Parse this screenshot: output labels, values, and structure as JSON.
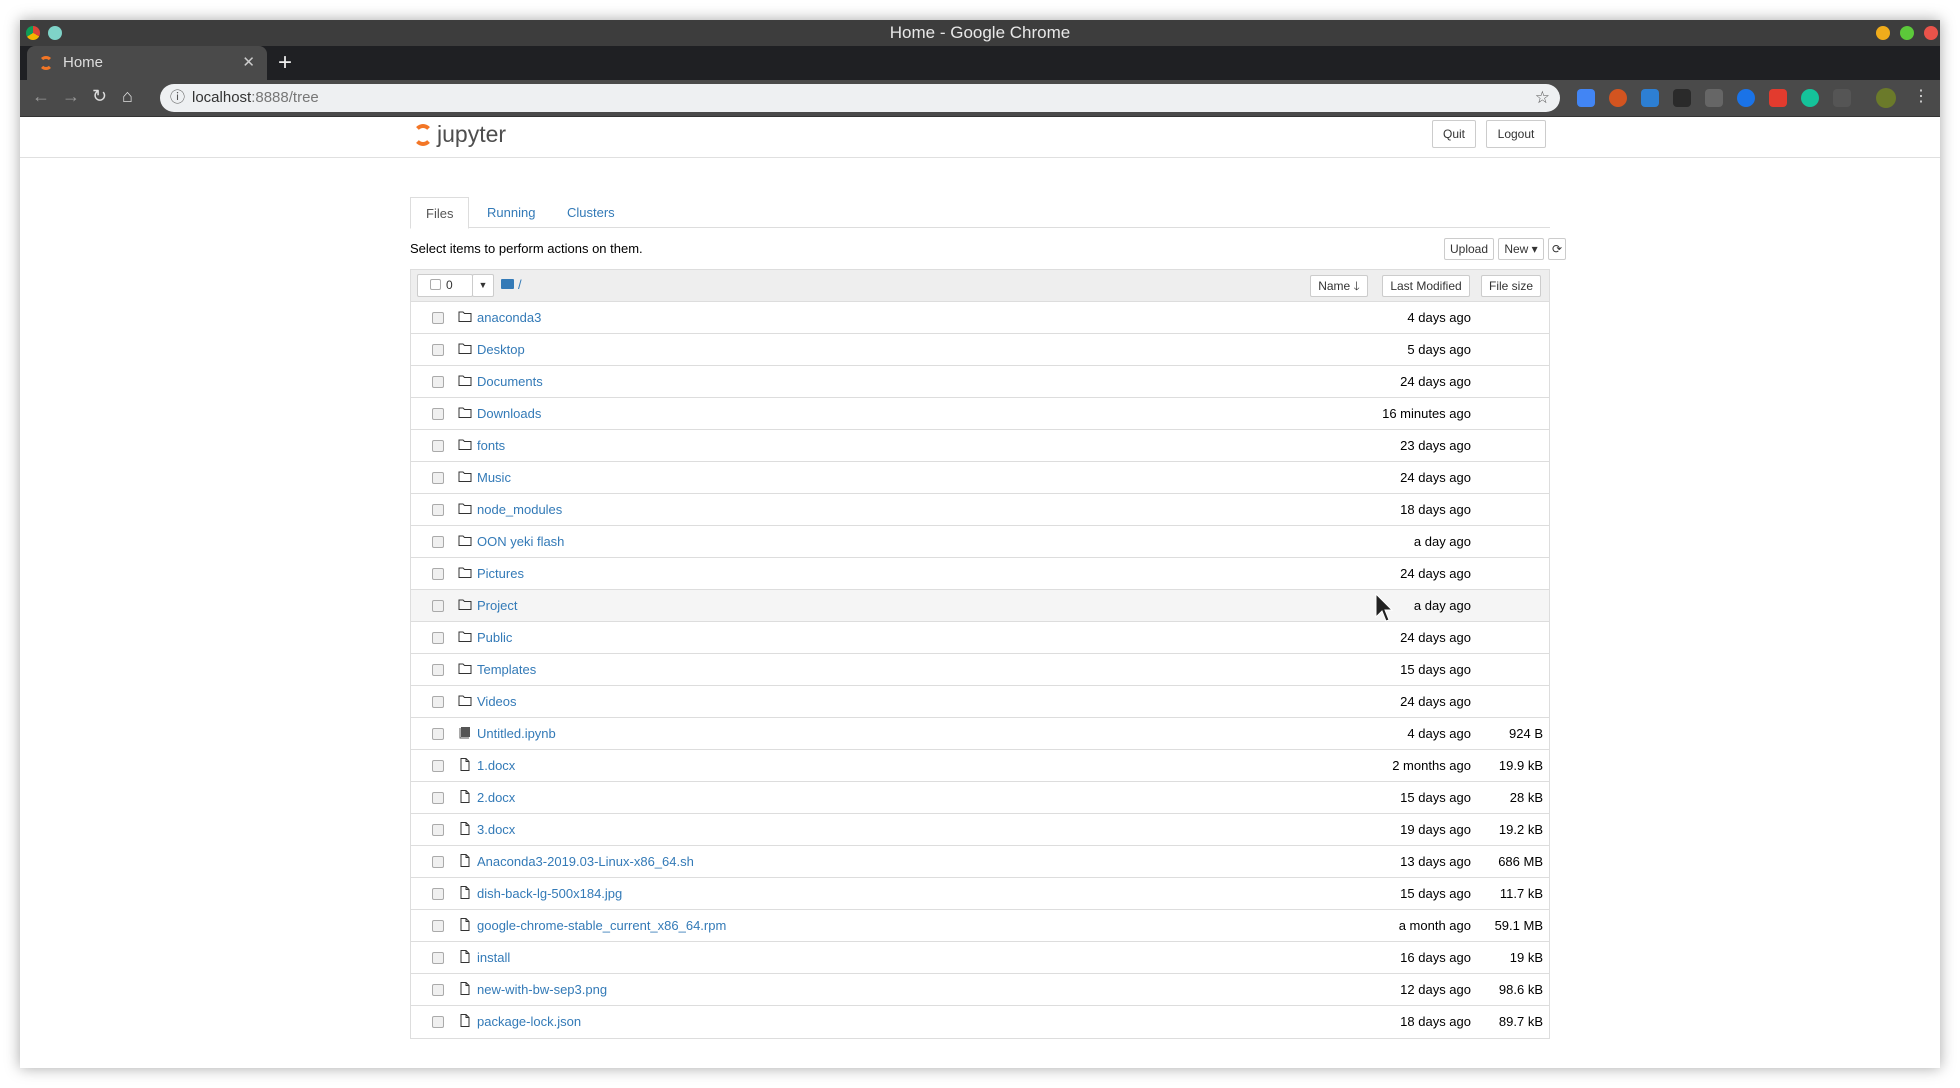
{
  "window": {
    "title": "Home - Google Chrome"
  },
  "browser": {
    "tab_title": "Home",
    "url_host": "localhost",
    "url_rest": ":8888/tree",
    "extensions": [
      "google-translate-icon",
      "wordpress-icon",
      "dictionary-icon",
      "wr-icon",
      "bulb-icon",
      "vpn-icon",
      "clipper-icon",
      "grammarly-icon",
      "puzzle-icon"
    ]
  },
  "header": {
    "logo_text": "jupyter",
    "quit_label": "Quit",
    "logout_label": "Logout"
  },
  "tabs": [
    {
      "label": "Files",
      "active": true
    },
    {
      "label": "Running"
    },
    {
      "label": "Clusters"
    }
  ],
  "hint": "Select items to perform actions on them.",
  "actions": {
    "upload": "Upload",
    "new": "New"
  },
  "list_header": {
    "selected_count": "0",
    "path": "/",
    "sort_name": "Name",
    "sort_modified": "Last Modified",
    "sort_size": "File size"
  },
  "items": [
    {
      "name": "anaconda3",
      "type": "folder",
      "modified": "4 days ago",
      "size": ""
    },
    {
      "name": "Desktop",
      "type": "folder",
      "modified": "5 days ago",
      "size": ""
    },
    {
      "name": "Documents",
      "type": "folder",
      "modified": "24 days ago",
      "size": ""
    },
    {
      "name": "Downloads",
      "type": "folder",
      "modified": "16 minutes ago",
      "size": ""
    },
    {
      "name": "fonts",
      "type": "folder",
      "modified": "23 days ago",
      "size": ""
    },
    {
      "name": "Music",
      "type": "folder",
      "modified": "24 days ago",
      "size": ""
    },
    {
      "name": "node_modules",
      "type": "folder",
      "modified": "18 days ago",
      "size": ""
    },
    {
      "name": "OON yeki flash",
      "type": "folder",
      "modified": "a day ago",
      "size": ""
    },
    {
      "name": "Pictures",
      "type": "folder",
      "modified": "24 days ago",
      "size": ""
    },
    {
      "name": "Project",
      "type": "folder",
      "modified": "a day ago",
      "size": ""
    },
    {
      "name": "Public",
      "type": "folder",
      "modified": "24 days ago",
      "size": ""
    },
    {
      "name": "Templates",
      "type": "folder",
      "modified": "15 days ago",
      "size": ""
    },
    {
      "name": "Videos",
      "type": "folder",
      "modified": "24 days ago",
      "size": ""
    },
    {
      "name": "Untitled.ipynb",
      "type": "notebook",
      "modified": "4 days ago",
      "size": "924 B"
    },
    {
      "name": "1.docx",
      "type": "file",
      "modified": "2 months ago",
      "size": "19.9 kB"
    },
    {
      "name": "2.docx",
      "type": "file",
      "modified": "15 days ago",
      "size": "28 kB"
    },
    {
      "name": "3.docx",
      "type": "file",
      "modified": "19 days ago",
      "size": "19.2 kB"
    },
    {
      "name": "Anaconda3-2019.03-Linux-x86_64.sh",
      "type": "file",
      "modified": "13 days ago",
      "size": "686 MB"
    },
    {
      "name": "dish-back-lg-500x184.jpg",
      "type": "file",
      "modified": "15 days ago",
      "size": "11.7 kB"
    },
    {
      "name": "google-chrome-stable_current_x86_64.rpm",
      "type": "file",
      "modified": "a month ago",
      "size": "59.1 MB"
    },
    {
      "name": "install",
      "type": "file",
      "modified": "16 days ago",
      "size": "19 kB"
    },
    {
      "name": "new-with-bw-sep3.png",
      "type": "file",
      "modified": "12 days ago",
      "size": "98.6 kB"
    },
    {
      "name": "package-lock.json",
      "type": "file",
      "modified": "18 days ago",
      "size": "89.7 kB"
    }
  ],
  "colors": {
    "link": "#337ab7",
    "jupyter_orange": "#f37626"
  }
}
